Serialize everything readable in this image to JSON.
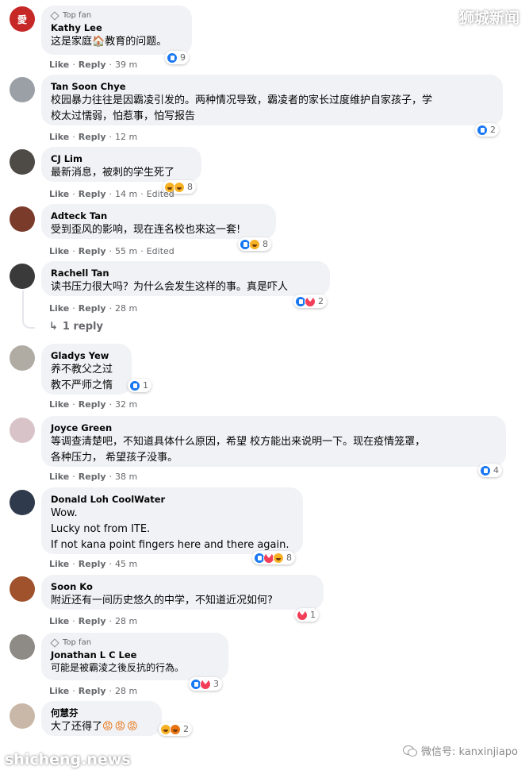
{
  "watermarks": {
    "top_right": "狮城新闻",
    "bottom_left": "shicheng.news",
    "bottom_right": "微信号: kanxinjiapo"
  },
  "actions": {
    "like": "Like",
    "reply": "Reply",
    "sep": "·"
  },
  "comments": [
    {
      "author": "Kathy Lee",
      "badge": "Top fan",
      "text_before": "这是家庭",
      "text_after": "教育的问题。",
      "icon": "house-emoji",
      "time": "39 m",
      "edited": "",
      "reactions": [
        "like"
      ],
      "count": "9",
      "avatar_text": "愛",
      "avatar_color": "#c62828"
    },
    {
      "author": "Tan Soon Chye",
      "badge": "",
      "text": "校园暴力往往是因霸凌引发的。两种情况导致，霸凌者的家长过度维护自家孩子，学\n校太过懦弱，怕惹事，怕写报告",
      "time": "12 m",
      "edited": "",
      "reactions": [
        "like"
      ],
      "count": "2",
      "avatar_color": "#9aa0a6"
    },
    {
      "author": "CJ Lim",
      "badge": "",
      "text": "最新消息，被刺的学生死了",
      "time": "14 m",
      "edited": "Edited",
      "reactions": [
        "wow",
        "sad"
      ],
      "count": "8",
      "avatar_color": "#4e4a46"
    },
    {
      "author": "Adteck Tan",
      "badge": "",
      "text": "受到歪风的影响，现在连名校也來这一套!",
      "time": "55 m",
      "edited": "Edited",
      "reactions": [
        "like",
        "haha"
      ],
      "count": "8",
      "avatar_color": "#7b3b2a"
    },
    {
      "author": "Rachell Tan",
      "badge": "",
      "text": "读书压力很大吗？为什么会发生这样的事。真是吓人",
      "time": "28 m",
      "edited": "",
      "reactions": [
        "like",
        "love"
      ],
      "count": "2",
      "avatar_color": "#3a3a3a",
      "reply_label": "1 reply"
    },
    {
      "author": "Gladys Yew",
      "badge": "",
      "text": "养不教父之过\n教不严师之惰",
      "time": "32 m",
      "edited": "",
      "reactions": [
        "like"
      ],
      "count": "1",
      "avatar_color": "#b0aca4"
    },
    {
      "author": "Joyce Green",
      "badge": "",
      "text": "等调查清楚吧，不知道具体什么原因，希望 校方能出来说明一下。现在疫情笼罩，\n各种压力， 希望孩子没事。",
      "time": "38 m",
      "edited": "",
      "reactions": [
        "like"
      ],
      "count": "4",
      "avatar_color": "#d8c4c8"
    },
    {
      "author": "Donald Loh CoolWater",
      "badge": "",
      "text": "Wow.\nLucky not from ITE.\nIf not kana point fingers here and there again.",
      "time": "45 m",
      "edited": "",
      "reactions": [
        "like",
        "love",
        "haha"
      ],
      "count": "8",
      "avatar_color": "#2f3b4c"
    },
    {
      "author": "Soon Ko",
      "badge": "",
      "text": "附近还有一间历史悠久的中学，不知道近况如何?",
      "time": "28 m",
      "edited": "",
      "reactions": [
        "love"
      ],
      "count": "1",
      "avatar_color": "#a0522d"
    },
    {
      "author": "Jonathan L C Lee",
      "badge": "Top fan",
      "text": "可能是被霸淩之後反抗的行為。",
      "time": "28 m",
      "edited": "",
      "reactions": [
        "like",
        "love"
      ],
      "count": "3",
      "avatar_color": "#8e8a86"
    },
    {
      "author": "何慧芬",
      "badge": "",
      "text": "大了还得了",
      "emojis": [
        "angry-face-emoji",
        "angry-face-emoji",
        "angry-face-emoji"
      ],
      "time": "",
      "edited": "",
      "reactions": [
        "haha",
        "angry"
      ],
      "count": "2",
      "avatar_color": "#c9b8a8"
    }
  ]
}
